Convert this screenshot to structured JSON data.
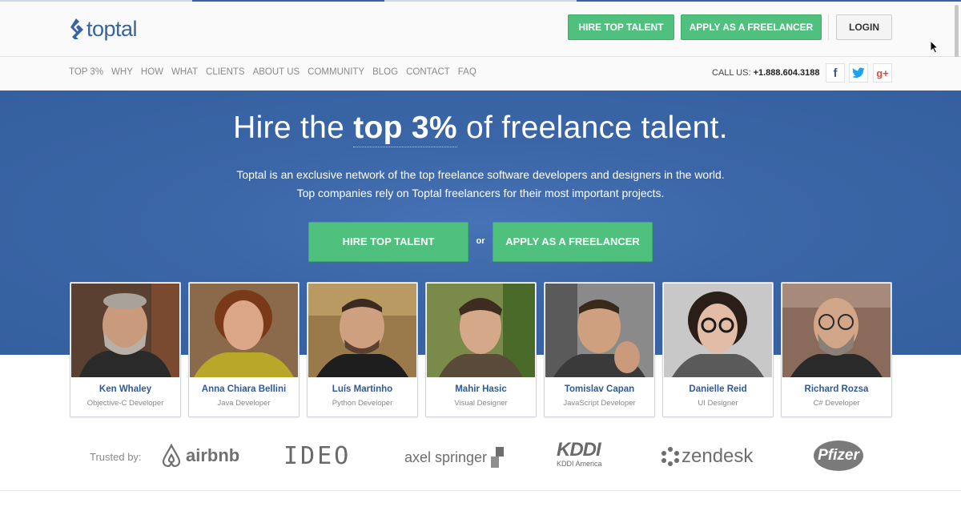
{
  "brand": {
    "name": "toptal"
  },
  "header": {
    "hire_label": "HIRE TOP TALENT",
    "apply_label": "APPLY AS A FREELANCER",
    "login_label": "LOGIN"
  },
  "nav": {
    "items": [
      "TOP 3%",
      "WHY",
      "HOW",
      "WHAT",
      "CLIENTS",
      "ABOUT US",
      "COMMUNITY",
      "BLOG",
      "CONTACT",
      "FAQ"
    ],
    "call_label": "CALL US:",
    "phone": "+1.888.604.3188",
    "social": [
      "facebook-icon",
      "twitter-icon",
      "google-plus-icon"
    ]
  },
  "hero": {
    "headline_pre": "Hire the ",
    "headline_highlight": "top 3%",
    "headline_post": " of freelance talent.",
    "line1": "Toptal is an exclusive network of the top freelance software developers and designers in the world.",
    "line2": "Top companies rely on Toptal freelancers for their most important projects.",
    "hire_label": "HIRE TOP TALENT",
    "or_label": "or",
    "apply_label": "APPLY AS A FREELANCER"
  },
  "freelancers": [
    {
      "name": "Ken Whaley",
      "role": "Objective-C Developer"
    },
    {
      "name": "Anna Chiara Bellini",
      "role": "Java Developer"
    },
    {
      "name": "Luís Martinho",
      "role": "Python Developer"
    },
    {
      "name": "Mahir Hasic",
      "role": "Visual Designer"
    },
    {
      "name": "Tomislav Capan",
      "role": "JavaScript Developer"
    },
    {
      "name": "Danielle Reid",
      "role": "UI Designer"
    },
    {
      "name": "Richard Rozsa",
      "role": "C# Developer"
    }
  ],
  "trusted": {
    "label": "Trusted by:",
    "logos": {
      "airbnb": "airbnb",
      "ideo": "IDEO",
      "axel": "axel springer",
      "kddi": "KDDI",
      "kddi_sub": "KDDI America",
      "zendesk": "zendesk",
      "pfizer": "Pfizer"
    }
  },
  "colors": {
    "brand_blue": "#3863a0",
    "hero_blue": "#3a65a6",
    "cta_green": "#4fc07e"
  }
}
